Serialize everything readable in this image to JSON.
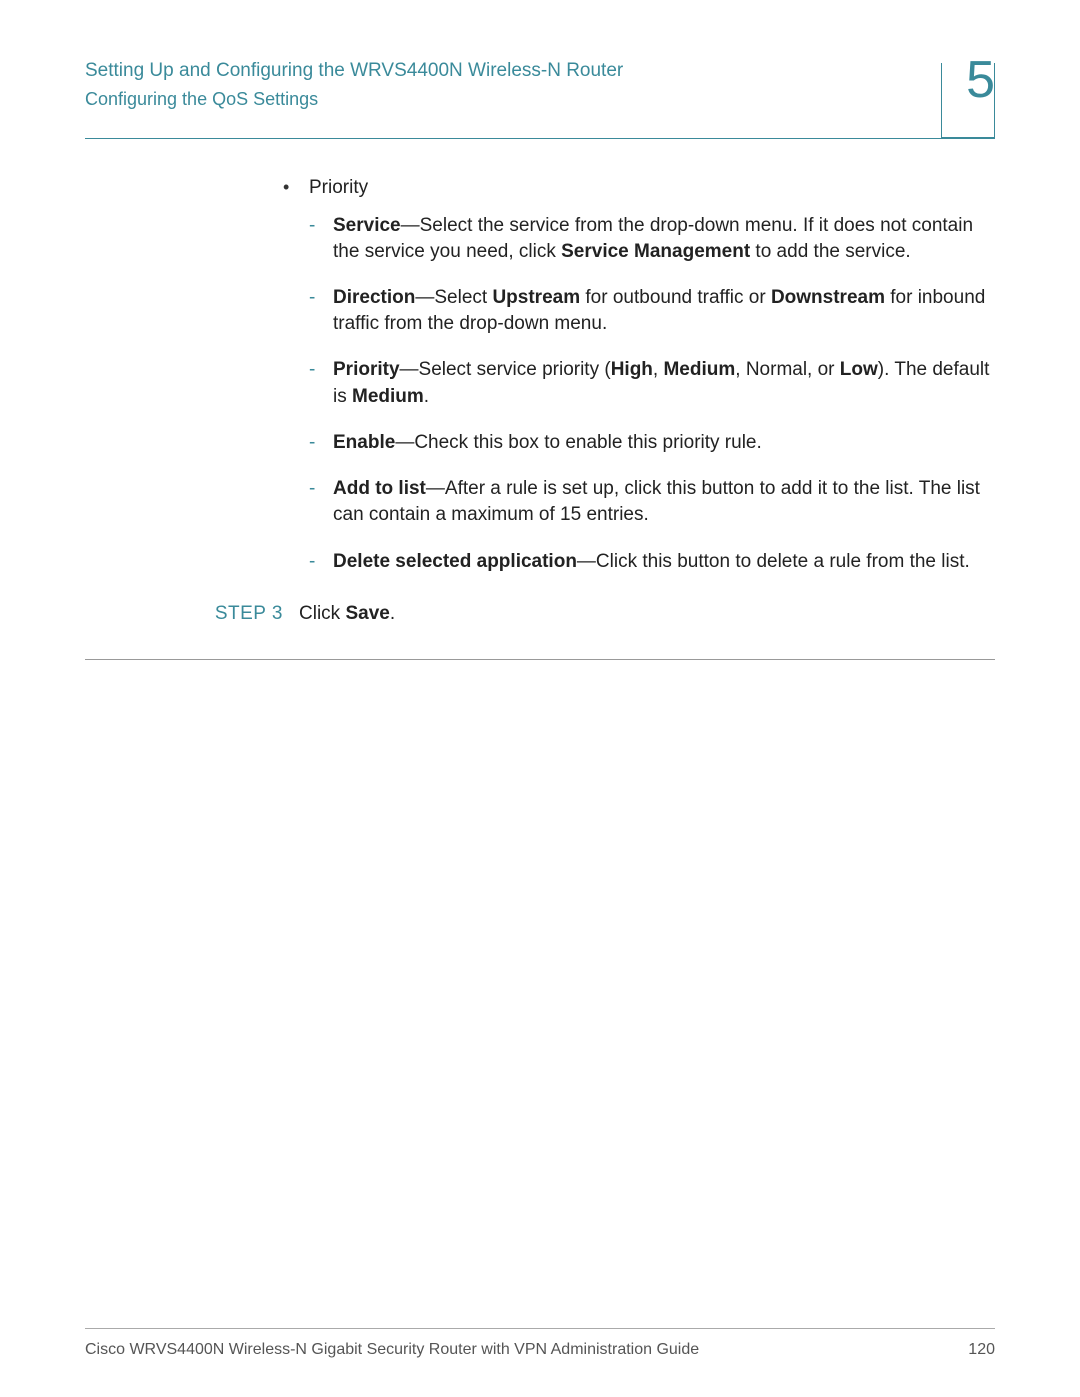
{
  "header": {
    "title": "Setting Up and Configuring the WRVS4400N Wireless-N Router",
    "subtitle": "Configuring the QoS Settings",
    "chapter": "5"
  },
  "content": {
    "bullet_marker": "•",
    "bullet_heading": "Priority",
    "sub_items": [
      {
        "dash": "-",
        "label": "Service",
        "sep": "—",
        "text_before": "Select the service from the drop-down menu. If it does not contain the service you need, click ",
        "bold_inline": "Service Management",
        "text_after": " to add the service."
      },
      {
        "dash": "-",
        "label": "Direction",
        "sep": "—",
        "text_before": "Select ",
        "bold1": "Upstream",
        "mid1": " for outbound traffic or ",
        "bold2": "Downstream",
        "text_after": " for inbound traffic from the drop-down menu."
      },
      {
        "dash": "-",
        "label": "Priority",
        "sep": "—",
        "text_before": "Select service priority (",
        "bold1": "High",
        "mid1": ", ",
        "bold2": "Medium",
        "mid2": ", Normal, or ",
        "bold3": "Low",
        "mid3": "). The default is ",
        "bold4": "Medium",
        "text_after": "."
      },
      {
        "dash": "-",
        "label": "Enable",
        "sep": "—",
        "text": "Check this box to enable this priority rule."
      },
      {
        "dash": "-",
        "label": "Add to list",
        "sep": "—",
        "text": "After a rule is set up, click this button to add it to the list. The list can contain a maximum of 15 entries."
      },
      {
        "dash": "-",
        "label": "Delete selected application",
        "sep": "—",
        "text": "Click this button to delete a rule from the list."
      }
    ],
    "step": {
      "label": "STEP 3",
      "text_before": "Click ",
      "bold": "Save",
      "text_after": "."
    }
  },
  "footer": {
    "guide": "Cisco WRVS4400N Wireless-N Gigabit Security Router with VPN Administration Guide",
    "page": "120"
  }
}
